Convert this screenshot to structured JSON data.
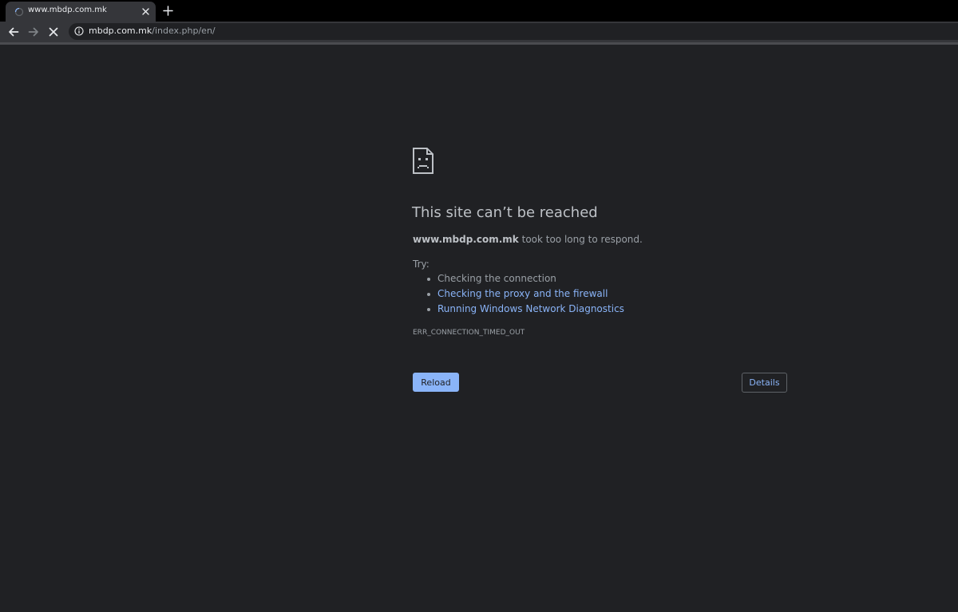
{
  "tab": {
    "title": "www.mbdp.com.mk",
    "loading": true,
    "icons": {
      "spinner": "loading-spinner-icon",
      "close": "close-icon"
    }
  },
  "new_tab": {
    "icon": "plus-icon"
  },
  "toolbar": {
    "icons": {
      "back": "arrow-left-icon",
      "forward": "arrow-right-icon",
      "stop": "stop-icon"
    },
    "omnibox": {
      "info_icon": "info-icon",
      "url_host": "mbdp.com.mk",
      "url_path": "/index.php/en/"
    }
  },
  "error_page": {
    "icon": "sad-page-icon",
    "heading": "This site can’t be reached",
    "host": "www.mbdp.com.mk",
    "message": " took too long to respond.",
    "try_label": "Try:",
    "suggestions": [
      {
        "text": "Checking the connection",
        "is_link": false
      },
      {
        "text": "Checking the proxy and the firewall",
        "is_link": true
      },
      {
        "text": "Running Windows Network Diagnostics",
        "is_link": true
      }
    ],
    "error_code": "ERR_CONNECTION_TIMED_OUT",
    "reload_label": "Reload",
    "details_label": "Details"
  },
  "colors": {
    "page_background": "#202124",
    "toolbar_background": "#35363a",
    "tabstrip_background": "#000000",
    "link": "#8ab4f8",
    "primary_button": "#8ab4f8",
    "heading_text": "#bdc1c6",
    "secondary_text": "#9aa0a6"
  }
}
